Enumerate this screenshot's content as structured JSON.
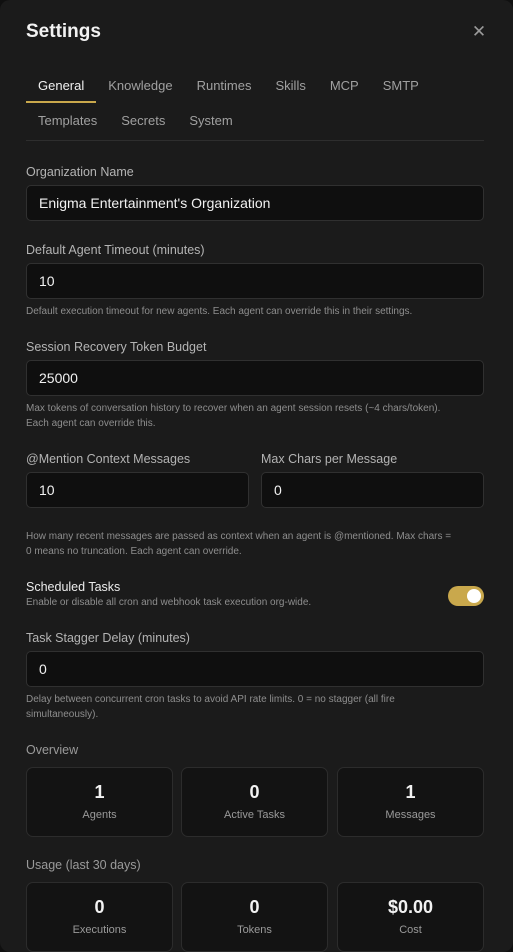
{
  "dialog": {
    "title": "Settings",
    "close_icon": "close-icon"
  },
  "tabs": {
    "row1": [
      "General",
      "Knowledge",
      "Runtimes",
      "Skills",
      "MCP",
      "SMTP"
    ],
    "row2": [
      "Templates",
      "Secrets",
      "System"
    ],
    "active": "General"
  },
  "general": {
    "org_name": {
      "label": "Organization Name",
      "value": "Enigma Entertainment's Organization"
    },
    "agent_timeout": {
      "label": "Default Agent Timeout (minutes)",
      "value": "10",
      "help": "Default execution timeout for new agents. Each agent can override this in their settings."
    },
    "token_budget": {
      "label": "Session Recovery Token Budget",
      "value": "25000",
      "help_line1": "Max tokens of conversation history to recover when an agent session resets (~4 chars/token).",
      "help_line2": "Each agent can override this."
    },
    "mention_context": {
      "label": "@Mention Context Messages",
      "value": "10"
    },
    "max_chars": {
      "label": "Max Chars per Message",
      "value": "0"
    },
    "mention_help_line1": "How many recent messages are passed as context when an agent is @mentioned. Max chars =",
    "mention_help_line2": "0 means no truncation. Each agent can override.",
    "scheduled_tasks": {
      "label": "Scheduled Tasks",
      "help": "Enable or disable all cron and webhook task execution org-wide.",
      "enabled": true,
      "toggle_color": "#c9a84c"
    },
    "stagger_delay": {
      "label": "Task Stagger Delay (minutes)",
      "value": "0",
      "help_line1": "Delay between concurrent cron tasks to avoid API rate limits. 0 = no stagger (all fire",
      "help_line2": "simultaneously)."
    }
  },
  "overview": {
    "title": "Overview",
    "cards": [
      {
        "value": "1",
        "caption": "Agents"
      },
      {
        "value": "0",
        "caption": "Active Tasks"
      },
      {
        "value": "1",
        "caption": "Messages"
      }
    ]
  },
  "usage": {
    "title": "Usage (last 30 days)",
    "cards": [
      {
        "value": "0",
        "caption": "Executions"
      },
      {
        "value": "0",
        "caption": "Tokens"
      },
      {
        "value": "$0.00",
        "caption": "Cost"
      }
    ]
  }
}
